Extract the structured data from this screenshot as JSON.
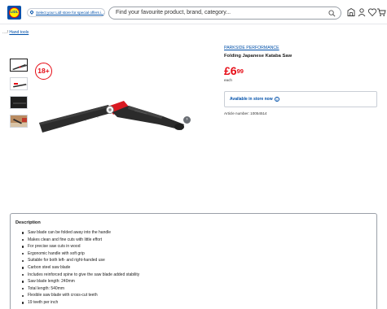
{
  "header": {
    "logo_text": "LIDL",
    "store_selector": "Select your Lidl store for special offers i...",
    "search": {
      "placeholder": "Find your favourite product, brand, category..."
    }
  },
  "breadcrumb": {
    "prefix": "... /",
    "current": "Hand tools"
  },
  "product": {
    "age_badge": "18+",
    "brand": "PARKSIDE PERFORMANCE",
    "title": "Folding Japanese Kataba Saw",
    "price_currency": "£",
    "price_whole": "6",
    "price_decimal": "99",
    "unit": "each",
    "availability": "Available in store now",
    "info_glyph": "i",
    "article_number": "Article number: 10054514",
    "next_glyph": "›"
  },
  "description": {
    "title": "Description",
    "bullets": [
      "Saw blade can be folded away into the handle",
      "Makes clean and fine cuts with little effort",
      "For precise saw cuts in wood",
      "Ergonomic handle with soft grip",
      "Suitable for both left- and right-handed use",
      "Carbon steel saw blade",
      "Includes reinforced spine to give the saw blade added stability",
      "Saw blade length: 240mm",
      "Total length: 540mm",
      "Flexible saw blade with cross-cut teeth",
      "19 teeth per inch"
    ]
  },
  "colors": {
    "brand_blue": "#0050aa",
    "price_red": "#e60a14",
    "logo_yellow": "#fff000"
  },
  "icons": [
    "location-pin-icon",
    "search-icon",
    "store-icon",
    "user-icon",
    "wishlist-icon",
    "cart-icon",
    "info-icon",
    "chevron-right-icon"
  ]
}
